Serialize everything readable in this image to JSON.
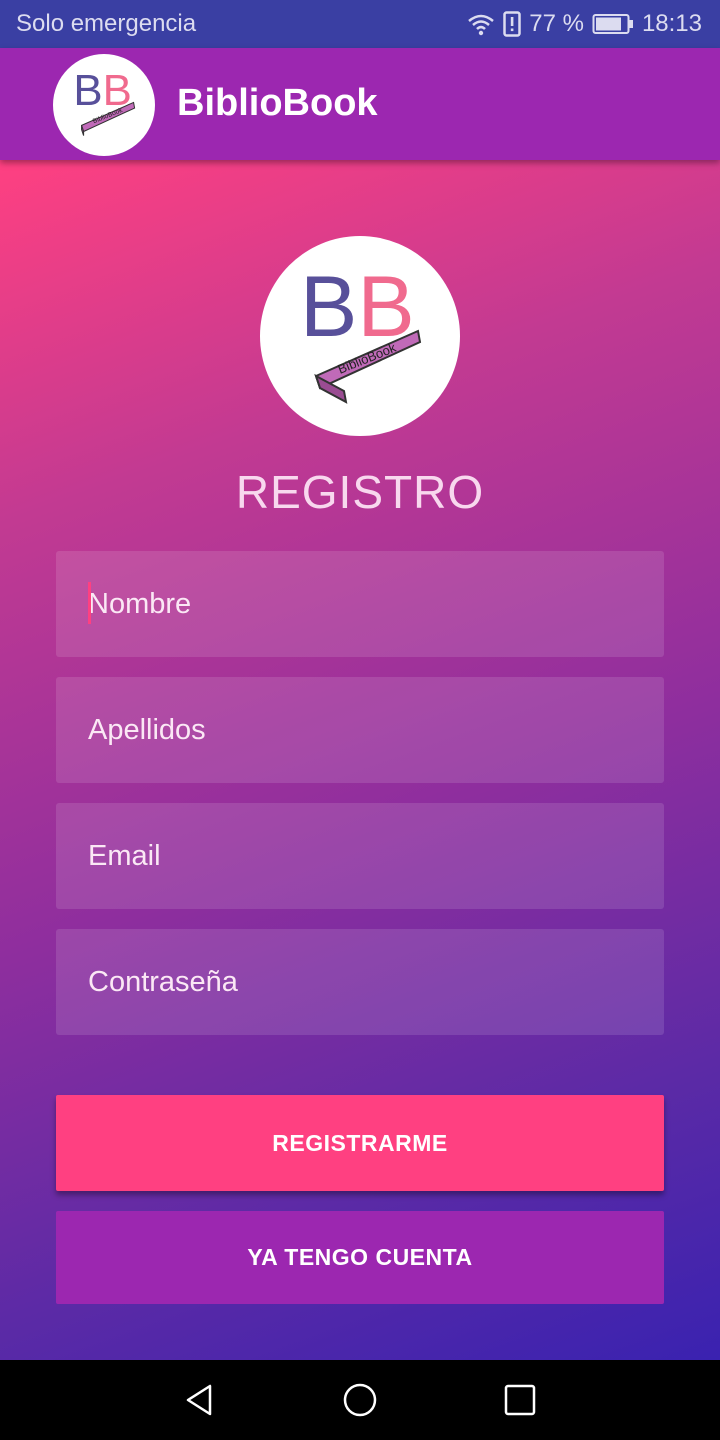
{
  "status_bar": {
    "carrier": "Solo emergencia",
    "battery": "77 %",
    "time": "18:13",
    "icons": [
      "wifi-icon",
      "alert-icon",
      "battery-icon"
    ]
  },
  "app_bar": {
    "title": "BiblioBook",
    "logo_letters": "BB",
    "logo_bar_text": "BiblioBook"
  },
  "form": {
    "heading": "REGISTRO",
    "fields": [
      {
        "name": "nombre",
        "placeholder": "Nombre",
        "value": ""
      },
      {
        "name": "apellidos",
        "placeholder": "Apellidos",
        "value": ""
      },
      {
        "name": "email",
        "placeholder": "Email",
        "value": ""
      },
      {
        "name": "contrasena",
        "placeholder": "Contraseña",
        "value": ""
      }
    ],
    "primary_button": "REGISTRARME",
    "secondary_button": "YA TENGO CUENTA"
  },
  "nav_bar": {
    "icons": [
      "back-icon",
      "home-icon",
      "recents-icon"
    ]
  },
  "colors": {
    "accent": "#ff4081",
    "primary": "#9c27b0",
    "status_bar": "#3a3fa3"
  }
}
